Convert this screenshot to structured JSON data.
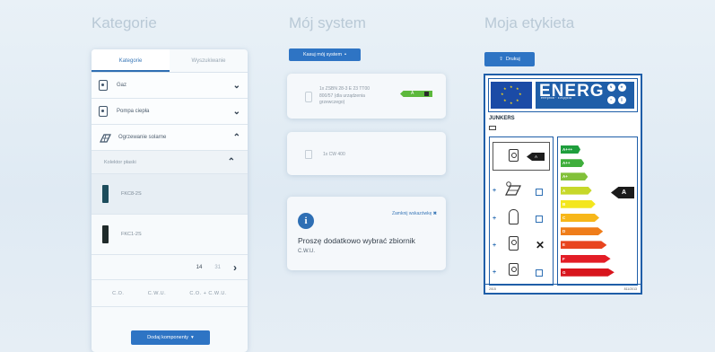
{
  "columns": {
    "categories_title": "Kategorie",
    "system_title": "Mój system",
    "label_title": "Moja etykieta"
  },
  "left_panel": {
    "tabs": [
      {
        "label": "Kategorie",
        "active": true
      },
      {
        "label": "Wyszukiwanie",
        "active": false
      }
    ],
    "categories": [
      {
        "label": "Gaz",
        "icon": "boiler-icon",
        "expanded": false
      },
      {
        "label": "Pompa ciepła",
        "icon": "heat-pump-icon",
        "expanded": false
      },
      {
        "label": "Ogrzewanie solarne",
        "icon": "solar-icon",
        "expanded": true
      }
    ],
    "subcategory": {
      "label": "Kolektor płaski",
      "expanded": true
    },
    "products": [
      {
        "label": "FKC8-2S",
        "swatch": "#1c4c5c",
        "selected": true
      },
      {
        "label": "FKC1-2S",
        "swatch": "#1f2a2a",
        "selected": false
      }
    ],
    "pager": {
      "current": "14",
      "next_page": "31"
    },
    "filters": [
      "C.O.",
      "C.W.U.",
      "C.O. + C.W.U."
    ],
    "add_button": "Dodaj komponenty"
  },
  "system": {
    "clear_button": "Kasuj mój system",
    "item1": {
      "text": "1x ZSBN 28-3 E 23 TT00 800/57 (dla urządzenia grzewczego)",
      "energy_class": "A"
    },
    "item2": {
      "text": "1x CW 400"
    },
    "message": {
      "close_link": "Zamknij wskazówkę",
      "text": "Proszę dodatkowo wybrać zbiornik",
      "sub": "C.W.U."
    }
  },
  "energy_label": {
    "print_button": "Drukuj",
    "heading": "ENERG",
    "heading_sub": "енергия · ενέργεια",
    "brand": "JUNKERS",
    "system_class": "A",
    "device_class": "A",
    "bands": [
      {
        "label": "A+++",
        "color": "#1e9e3c"
      },
      {
        "label": "A++",
        "color": "#3fae3c"
      },
      {
        "label": "A+",
        "color": "#82c13a"
      },
      {
        "label": "A",
        "color": "#c7d82a"
      },
      {
        "label": "B",
        "color": "#f3e61e"
      },
      {
        "label": "C",
        "color": "#f7b71a"
      },
      {
        "label": "D",
        "color": "#ef7d1a"
      },
      {
        "label": "E",
        "color": "#e8451f"
      },
      {
        "label": "F",
        "color": "#e31d26"
      },
      {
        "label": "G",
        "color": "#d8151d"
      }
    ],
    "footer_left": "2015",
    "footer_right": "811/2013"
  }
}
